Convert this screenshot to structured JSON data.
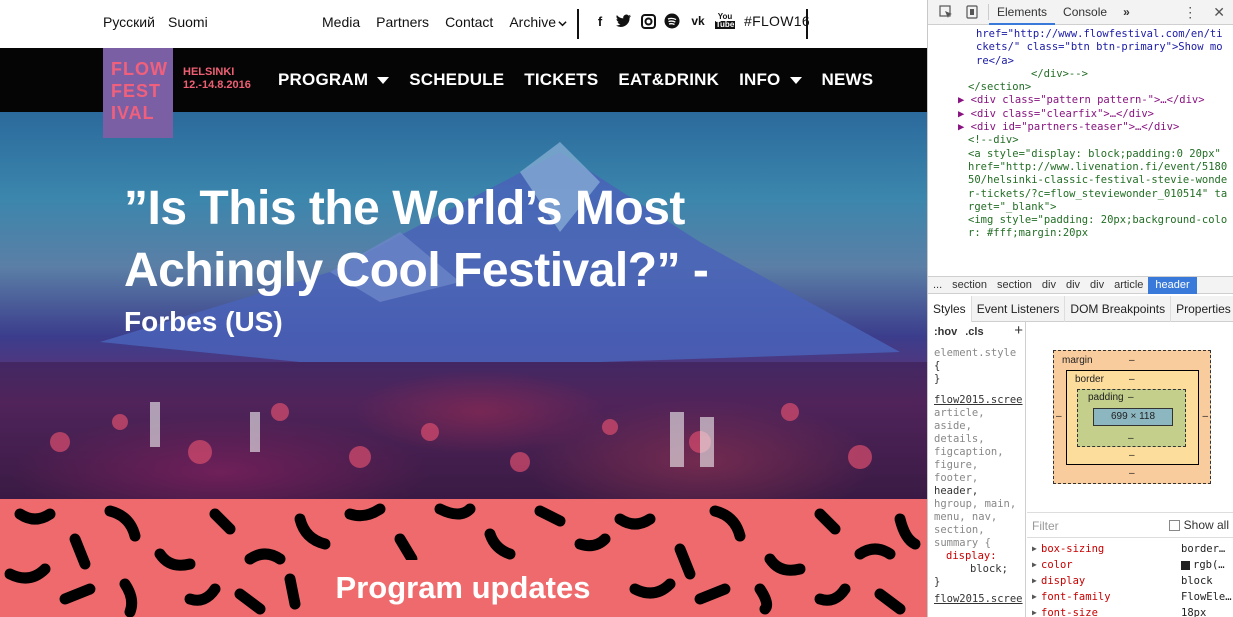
{
  "site": {
    "languages": [
      "Русский",
      "Suomi"
    ],
    "top_links": [
      "Media",
      "Partners",
      "Contact",
      "Archive"
    ],
    "hashtag": "#FLOW16",
    "logo_lines": [
      "FLOW",
      "FEST",
      "IVAL"
    ],
    "location": "HELSINKI",
    "dates": "12.-14.8.2016",
    "nav": [
      "PROGRAM",
      "SCHEDULE",
      "TICKETS",
      "EAT&DRINK",
      "INFO",
      "NEWS"
    ],
    "hero_quote": "”Is This the World’s Most Achingly Cool Festival?” -",
    "hero_source": "Forbes (US)",
    "section_title": "Program updates",
    "colors": {
      "brand_coral": "#ef6a6c",
      "logo_bg": "#7a5fa5",
      "logo_text": "#f0607c",
      "nav_bg": "#050505"
    },
    "socials": [
      "facebook-icon",
      "twitter-icon",
      "instagram-icon",
      "spotify-icon",
      "vk-icon",
      "youtube-icon"
    ]
  },
  "devtools": {
    "tabs": [
      "Elements",
      "Console"
    ],
    "code_lines": [
      {
        "kind": "attr",
        "text": "href=\"http://www.flowfestival.com/en/tickets/\" class=\"btn btn-primary\">Show more</a>"
      },
      {
        "kind": "comment",
        "text": "</div>-->"
      },
      {
        "kind": "tag",
        "text": "</section>"
      },
      {
        "kind": "tag",
        "text": "<div class=\"pattern pattern-\">…</div>"
      },
      {
        "kind": "tag",
        "text": "<div class=\"clearfix\">…</div>"
      },
      {
        "kind": "tag",
        "text": "<div id=\"partners-teaser\">…</div>"
      },
      {
        "kind": "comment",
        "text": "<!--div>"
      },
      {
        "kind": "comment",
        "text": "<a style=\"display: block;padding:0 20px\" href=\"http://www.livenation.fi/event/518050/helsinki-classic-festival-stevie-wonder-tickets/?c=flow_steviewonder_010514\" target=\"_blank\">"
      },
      {
        "kind": "comment",
        "text": "<img style=\"padding: 20px;background-color: #fff;margin:20px"
      }
    ],
    "breadcrumbs": [
      "...",
      "section",
      "section",
      "div",
      "div",
      "div",
      "article",
      "header"
    ],
    "panel_tabs": [
      "Styles",
      "Event Listeners",
      "DOM Breakpoints",
      "Properties"
    ],
    "styles": {
      "hov": ":hov",
      "cls": ".cls",
      "element_style": "element.style",
      "open_brace": "{",
      "close_brace": "}",
      "source": "flow2015.scree",
      "selectors": [
        "article,",
        "aside,",
        "details,",
        "figcaption,",
        "figure,",
        "footer,",
        "header,",
        "hgroup, main,",
        "menu, nav,",
        "section,",
        "summary {"
      ],
      "display_prop": "display:",
      "display_val": "block;",
      "source2": "flow2015.scree"
    },
    "box_model": {
      "margin_label": "margin",
      "border_label": "border",
      "padding_label": "padding",
      "dash": "–",
      "content": "699 × 118"
    },
    "filter_placeholder": "Filter",
    "show_all": "Show all",
    "computed": [
      {
        "name": "box-sizing",
        "value": "border…"
      },
      {
        "name": "color",
        "value": "rgb(…"
      },
      {
        "name": "display",
        "value": "block"
      },
      {
        "name": "font-family",
        "value": "FlowEle…"
      },
      {
        "name": "font-size",
        "value": "18px"
      }
    ]
  }
}
